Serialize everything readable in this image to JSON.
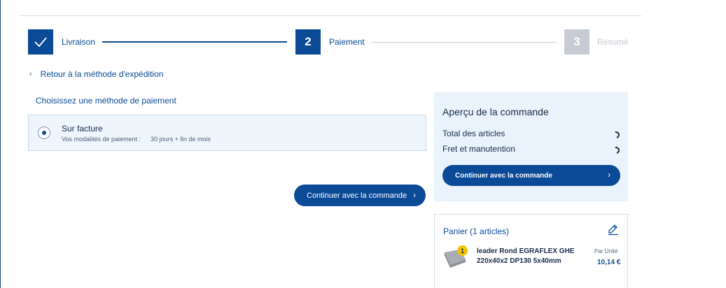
{
  "stepper": {
    "steps": [
      {
        "number": "1",
        "label": "Livraison",
        "state": "done"
      },
      {
        "number": "2",
        "label": "Paiement",
        "state": "active"
      },
      {
        "number": "3",
        "label": "Résumé",
        "state": "pending"
      }
    ]
  },
  "back_link": {
    "label": "Retour à la méthode d'expédition"
  },
  "payment": {
    "title": "Choisissez une méthode de paiement",
    "method_name": "Sur facture",
    "terms_label": "Vos modalités de paiement :",
    "terms_value": "30 jours + fin de mois"
  },
  "main_button": {
    "label": "Continuer avec la commande"
  },
  "overview": {
    "title": "Aperçu de la commande",
    "rows": [
      {
        "label": "Total des articles"
      },
      {
        "label": "Fret et manutention"
      }
    ],
    "button_label": "Continuer avec la commande"
  },
  "cart": {
    "title": "Panier (1 articles)",
    "items": [
      {
        "quantity": "1",
        "name": "leader Rond EGRAFLEX GHE 220x40x2 DP130 5x40mm",
        "unit_label": "Par Unité",
        "price": "10,14 €"
      }
    ]
  },
  "colors": {
    "primary": "#0b4a96",
    "panel": "#eaf3fb",
    "badge": "#f2c400",
    "inactive": "#c7ccd4"
  }
}
